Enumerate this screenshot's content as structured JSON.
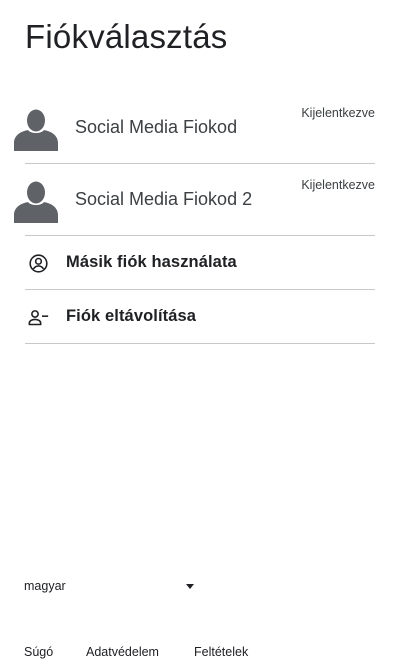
{
  "header": {
    "title": "Fiókválasztás"
  },
  "accounts": [
    {
      "name": "Social Media Fiokod",
      "status": "Kijelentkezve",
      "icon": "person-silhouette-icon"
    },
    {
      "name": "Social Media Fiokod 2",
      "status": "Kijelentkezve",
      "icon": "person-silhouette-icon"
    }
  ],
  "actions": [
    {
      "label": "Másik fiók használata",
      "icon": "account-circle-icon"
    },
    {
      "label": "Fiók eltávolítása",
      "icon": "person-remove-icon"
    }
  ],
  "language": {
    "selected": "magyar",
    "icon": "chevron-down-icon"
  },
  "footer": {
    "help": "Súgó",
    "privacy": "Adatvédelem",
    "terms": "Feltételek"
  },
  "colors": {
    "text": "#202124",
    "divider": "#c8c8c8",
    "avatar": "#5f6368"
  }
}
